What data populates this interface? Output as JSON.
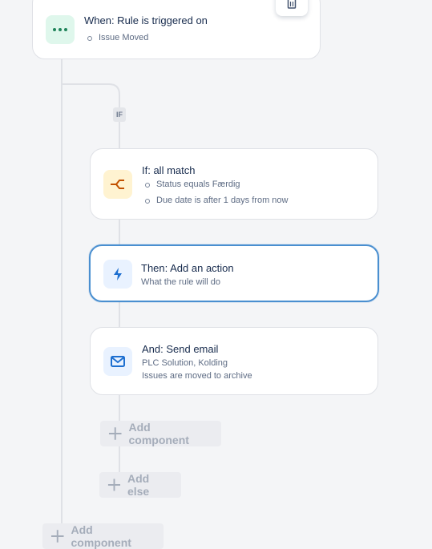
{
  "trigger": {
    "title": "When: Rule is triggered on",
    "detail": "Issue Moved"
  },
  "branch_badge": "IF",
  "condition": {
    "title": "If: all match",
    "items": [
      "Status equals Færdig",
      "Due date is after 1 days from now"
    ]
  },
  "action_placeholder": {
    "title": "Then: Add an action",
    "subtitle": "What the rule will do"
  },
  "email_action": {
    "title": "And: Send email",
    "line1": "PLC Solution, Kolding",
    "line2": "Issues are moved to archive"
  },
  "buttons": {
    "add_component_inner": "Add component",
    "add_else": "Add else",
    "add_component_outer": "Add component"
  },
  "colors": {
    "trigger_icon_bg": "#dff7ec",
    "trigger_icon_fg": "#1f845a",
    "condition_icon_bg": "#fff3d1",
    "condition_icon_fg": "#c25100",
    "action_icon_bg": "#e9f2ff",
    "action_icon_fg": "#1d6fd0",
    "selected_border": "#4a8fd0"
  },
  "icons": {
    "trigger": "more-dots-icon",
    "condition": "branch-condition-icon",
    "action": "lightning-icon",
    "email": "envelope-icon",
    "delete": "trash-icon",
    "add": "plus-icon"
  }
}
